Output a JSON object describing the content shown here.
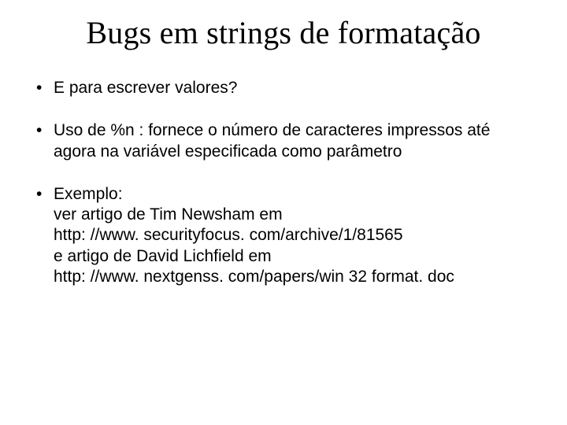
{
  "title": "Bugs em strings de formatação",
  "bullets": {
    "b1": "E para escrever valores?",
    "b2": "Uso de %n : fornece o número de caracteres impressos até agora na variável especificada como parâmetro",
    "b3": {
      "l1": "Exemplo:",
      "l2": "ver artigo de Tim Newsham em",
      "l3": "http: //www. securityfocus. com/archive/1/81565",
      "l4": "e artigo de David Lichfield em",
      "l5": "http: //www. nextgenss. com/papers/win 32 format. doc"
    }
  }
}
